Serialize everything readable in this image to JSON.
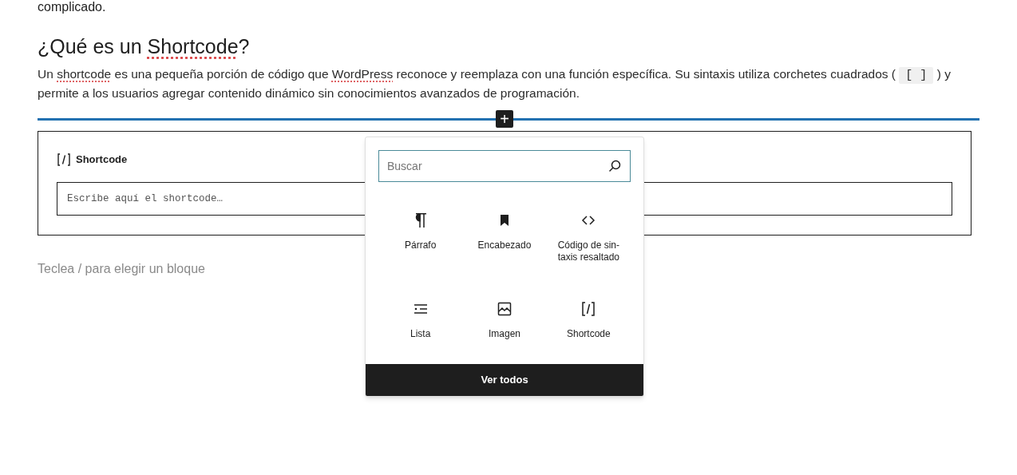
{
  "previous_text": "complicado.",
  "heading": [
    {
      "text": "¿Qué es un ",
      "kind": "text"
    },
    {
      "text": "Shortcode",
      "kind": "misspelled"
    },
    {
      "text": "?",
      "kind": "text"
    }
  ],
  "paragraph": [
    {
      "text": "Un ",
      "kind": "text"
    },
    {
      "text": "shortcode",
      "kind": "misspelled"
    },
    {
      "text": " es una pequeña porción de código que ",
      "kind": "text"
    },
    {
      "text": "WordPress",
      "kind": "misspelled"
    },
    {
      "text": " reconoce y reemplaza con una función específica. Su sintaxis utiliza corchetes cuadrados ( ",
      "kind": "text"
    },
    {
      "text": "[ ]",
      "kind": "code"
    },
    {
      "text": " ) y permite a los usuarios agregar contenido dinámico sin conocimientos avanzados de programación.",
      "kind": "text"
    }
  ],
  "inserter_button": "+",
  "shortcode_block": {
    "label": "Shortcode",
    "placeholder": "Escribe aquí el shortcode…"
  },
  "block_prompt": "Teclea / para elegir un bloque",
  "inserter": {
    "search": {
      "placeholder": "Buscar"
    },
    "blocks": [
      {
        "label": "Párrafo",
        "kind": "paragraph"
      },
      {
        "label": "Encabezado",
        "kind": "heading"
      },
      {
        "label": "Código de sin-taxis resaltado",
        "kind": "code"
      },
      {
        "label": "Lista",
        "kind": "list"
      },
      {
        "label": "Imagen",
        "kind": "image"
      },
      {
        "label": "Shortcode",
        "kind": "shortcode"
      }
    ],
    "browse_all": "Ver todos"
  }
}
